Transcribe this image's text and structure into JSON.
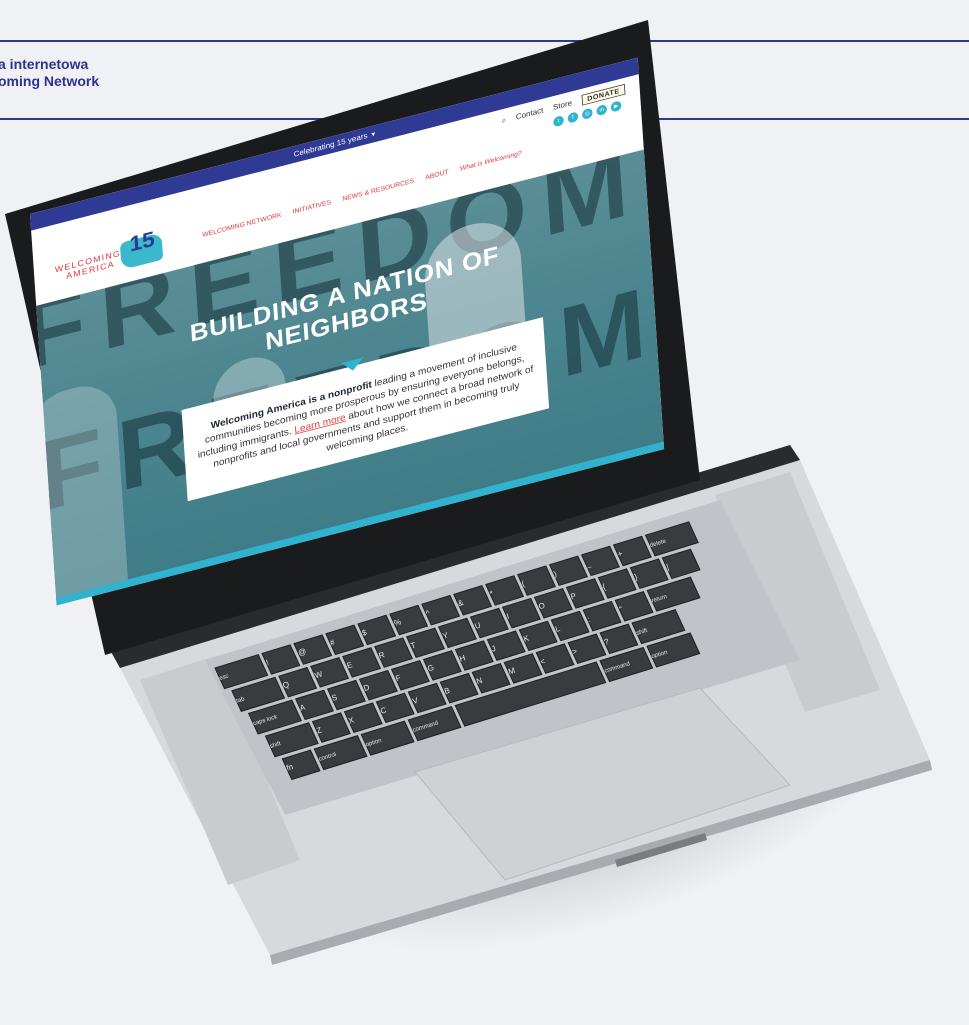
{
  "caption": {
    "line1": "a internetowa",
    "line2": "oming Network"
  },
  "website": {
    "topbar": "Celebrating 15 years",
    "utility": {
      "search_icon": "search-icon",
      "contact": "Contact",
      "store": "Store",
      "donate": "DONATE"
    },
    "social_icons": [
      "twitter-icon",
      "facebook-icon",
      "instagram-icon",
      "linkedin-icon",
      "youtube-icon"
    ],
    "logo": {
      "word1": "WELCOMING",
      "word2": "AMERICA",
      "number": "15"
    },
    "nav": [
      "WELCOMING NETWORK",
      "INITIATIVES",
      "NEWS & RESOURCES",
      "ABOUT",
      "What is Welcoming?"
    ],
    "hero": {
      "title_line1": "BUILDING A NATION OF",
      "title_line2": "NEIGHBORS",
      "bg_word1": "FREEDOM",
      "bg_word2": "FREEDOM"
    },
    "mission": {
      "bold": "Welcoming America is a nonprofit",
      "text1": " leading a movement of inclusive communities becoming more prosperous by ensuring everyone belongs, including immigrants. ",
      "link": "Learn more",
      "text2": " about how we connect a broad network of nonprofits and local governments and support them in becoming truly welcoming places."
    }
  },
  "colors": {
    "brand_blue": "#2e3a94",
    "brand_red": "#e2383f",
    "accent_teal": "#2fb3cf"
  },
  "keyboard": {
    "row1": [
      "esc",
      "!",
      "@",
      "#",
      "$",
      "%",
      "^",
      "&",
      "*",
      "(",
      ")",
      "_",
      "+",
      "delete"
    ],
    "row2": [
      "tab",
      "Q",
      "W",
      "E",
      "R",
      "T",
      "Y",
      "U",
      "I",
      "O",
      "P",
      "{",
      "}",
      "|"
    ],
    "row3": [
      "caps lock",
      "A",
      "S",
      "D",
      "F",
      "G",
      "H",
      "J",
      "K",
      "L",
      ":",
      "\"",
      "return"
    ],
    "row4": [
      "shift",
      "Z",
      "X",
      "C",
      "V",
      "B",
      "N",
      "M",
      "<",
      ">",
      "?",
      "shift"
    ],
    "row5": [
      "fn",
      "control",
      "option",
      "command",
      "",
      "command",
      "option"
    ]
  }
}
